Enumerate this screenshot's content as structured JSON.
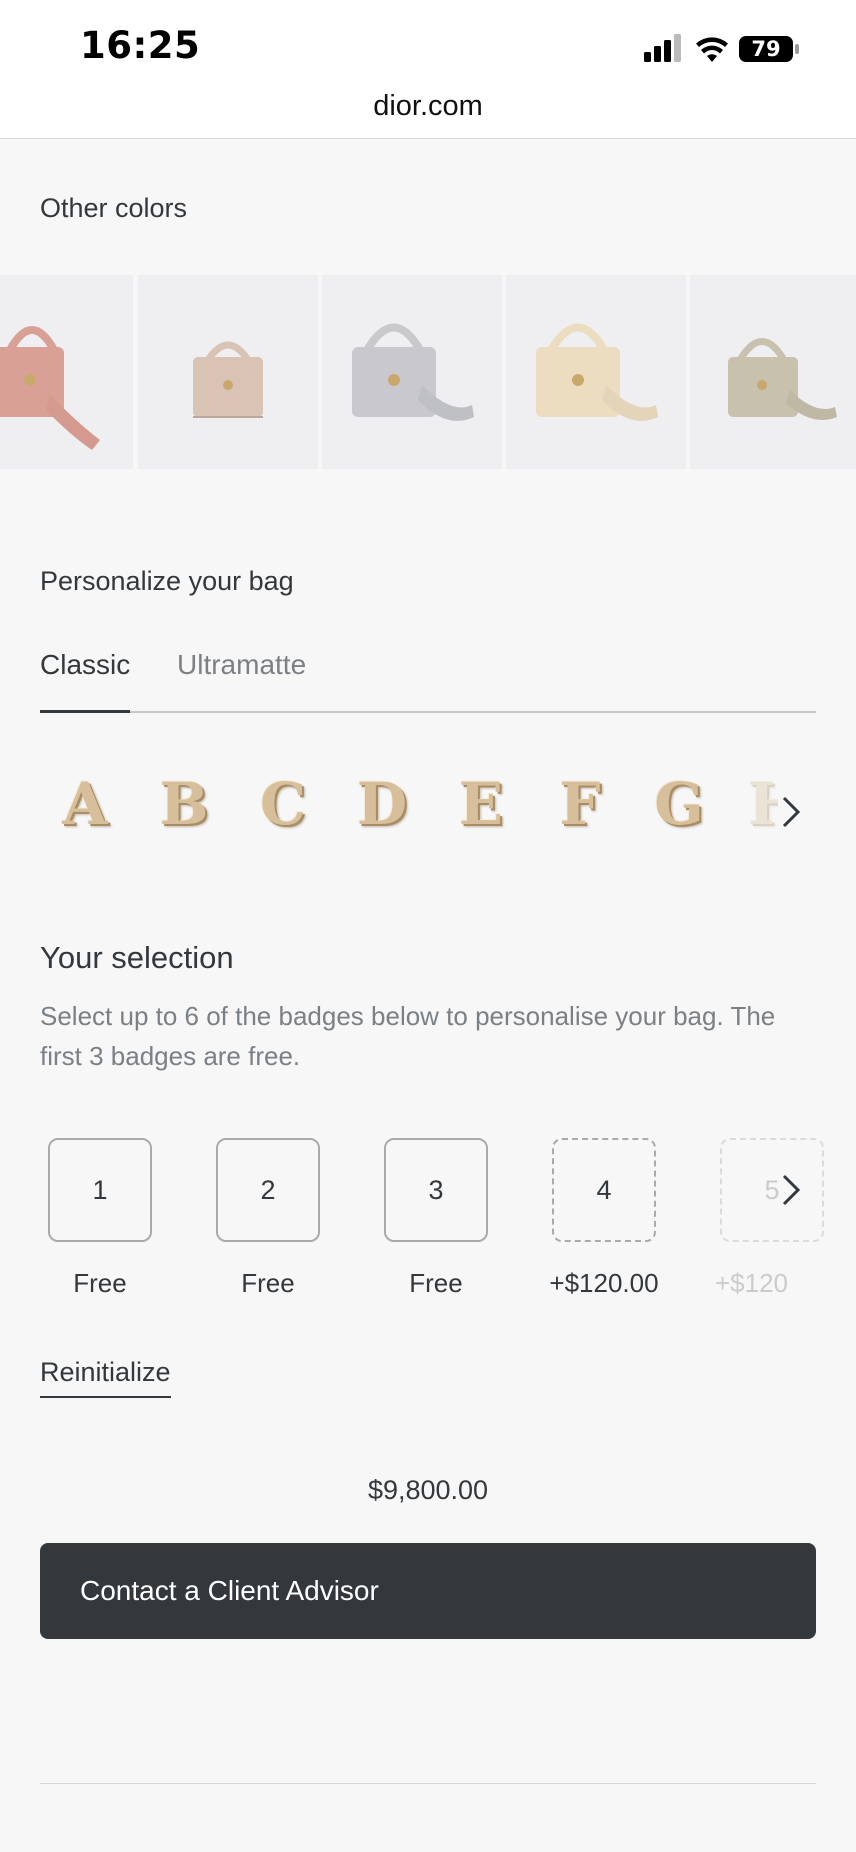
{
  "status_bar": {
    "time": "16:25",
    "battery": "79"
  },
  "browser": {
    "url": "dior.com"
  },
  "other_colors": {
    "title": "Other colors",
    "swatches": [
      {
        "name": "pink",
        "bag_color": "#d9a196"
      },
      {
        "name": "nude",
        "bag_color": "#d9c3b4"
      },
      {
        "name": "grey",
        "bag_color": "#c9c9cd"
      },
      {
        "name": "cream",
        "bag_color": "#ecdcc0"
      },
      {
        "name": "taupe",
        "bag_color": "#c8c1ae"
      }
    ]
  },
  "personalize": {
    "title": "Personalize your bag",
    "tabs": [
      {
        "label": "Classic",
        "active": true
      },
      {
        "label": "Ultramatte",
        "active": false
      }
    ],
    "letters": [
      "A",
      "B",
      "C",
      "D",
      "E",
      "F",
      "G",
      "H"
    ]
  },
  "selection": {
    "title": "Your selection",
    "description": "Select up to 6 of the badges below to personalise your bag. The first 3 badges are free.",
    "badges": [
      {
        "number": "1",
        "price": "Free"
      },
      {
        "number": "2",
        "price": "Free"
      },
      {
        "number": "3",
        "price": "Free"
      },
      {
        "number": "4",
        "price": "+$120.00"
      },
      {
        "number": "5",
        "price": "+$120"
      }
    ],
    "reinitialize_label": "Reinitialize"
  },
  "purchase": {
    "price": "$9,800.00",
    "cta_label": "Contact a Client Advisor"
  },
  "colors": {
    "primary": "#33383c",
    "background": "#f7f7f8",
    "muted_text": "#7b8085"
  }
}
